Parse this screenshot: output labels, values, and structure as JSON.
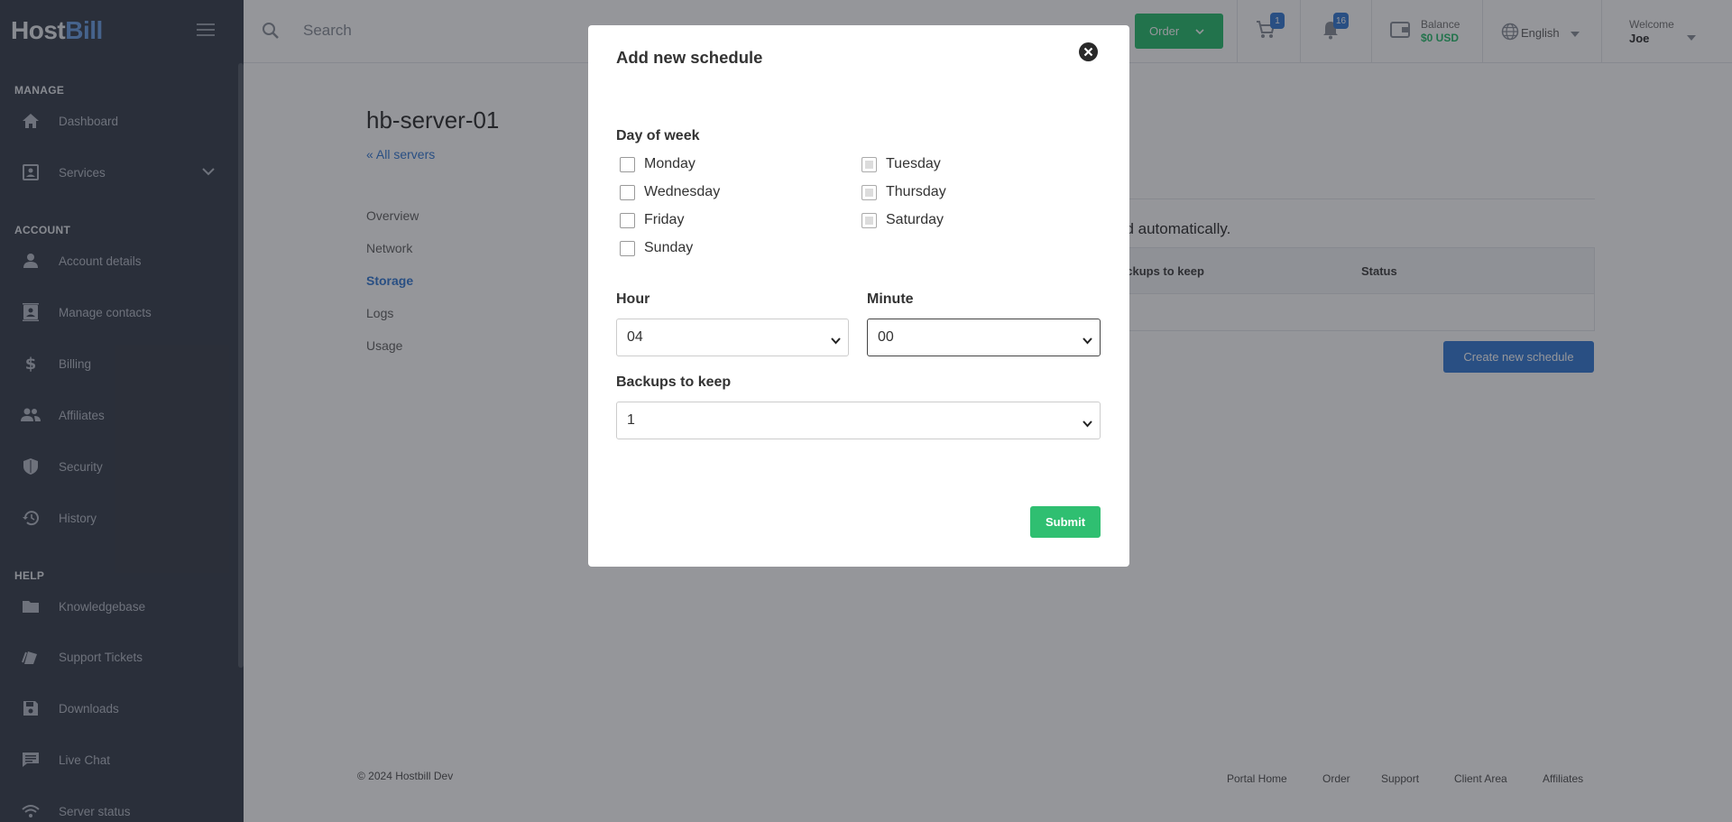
{
  "brand": {
    "host": "Host",
    "bill": "Bill"
  },
  "sidebar": {
    "sections": [
      {
        "title": "MANAGE"
      },
      {
        "title": "ACCOUNT"
      },
      {
        "title": "HELP"
      }
    ],
    "items": [
      {
        "label": "Dashboard",
        "icon": "home-icon"
      },
      {
        "label": "Services",
        "icon": "services-icon"
      },
      {
        "label": "Account details",
        "icon": "person-icon"
      },
      {
        "label": "Manage contacts",
        "icon": "contacts-icon"
      },
      {
        "label": "Billing",
        "icon": "dollar-icon"
      },
      {
        "label": "Affiliates",
        "icon": "people-icon"
      },
      {
        "label": "Security",
        "icon": "shield-icon"
      },
      {
        "label": "History",
        "icon": "history-icon"
      },
      {
        "label": "Knowledgebase",
        "icon": "folder-icon"
      },
      {
        "label": "Support Tickets",
        "icon": "ticket-icon"
      },
      {
        "label": "Downloads",
        "icon": "save-icon"
      },
      {
        "label": "Live Chat",
        "icon": "chat-icon"
      },
      {
        "label": "Server status",
        "icon": "wifi-icon"
      }
    ]
  },
  "header": {
    "search_placeholder": "Search",
    "order_label": "Order",
    "cart_count": "1",
    "notifications_count": "16",
    "balance_label": "Balance",
    "balance_value": "$0 USD",
    "language": "English",
    "welcome": "Welcome",
    "user": "Joe"
  },
  "content": {
    "title": "hb-server-01",
    "back_link": "« All servers",
    "tabs": [
      "Overview",
      "Network",
      "Storage",
      "Logs",
      "Usage"
    ],
    "active_tab": "Storage",
    "auto_text": "ed automatically.",
    "table_headers": [
      "ackups to keep",
      "Status"
    ],
    "create_button": "Create new schedule"
  },
  "footer": {
    "copyright": "© 2024 Hostbill Dev",
    "links": [
      "Portal Home",
      "Order",
      "Support",
      "Client Area",
      "Affiliates"
    ]
  },
  "modal": {
    "title": "Add new schedule",
    "day_label": "Day of week",
    "days": [
      {
        "label": "Monday",
        "checked": false
      },
      {
        "label": "Tuesday",
        "checked": false
      },
      {
        "label": "Wednesday",
        "checked": false
      },
      {
        "label": "Thursday",
        "checked": false
      },
      {
        "label": "Friday",
        "checked": false
      },
      {
        "label": "Saturday",
        "checked": false
      },
      {
        "label": "Sunday",
        "checked": false
      }
    ],
    "hour_label": "Hour",
    "hour_value": "04",
    "minute_label": "Minute",
    "minute_value": "00",
    "keep_label": "Backups to keep",
    "keep_value": "1",
    "submit": "Submit"
  },
  "colors": {
    "accent": "#3b7ed6",
    "success": "#2fbf71",
    "sidebar": "#3d4450"
  }
}
